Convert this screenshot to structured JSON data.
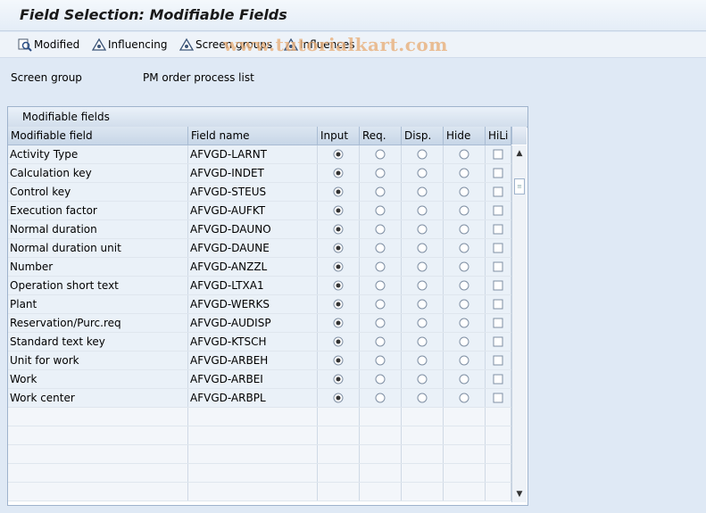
{
  "window": {
    "title": "Field Selection: Modifiable Fields"
  },
  "toolbar": {
    "buttons": [
      {
        "label": "Modified",
        "icon": "modified-icon"
      },
      {
        "label": "Influencing",
        "icon": "influencing-icon"
      },
      {
        "label": "Screen groups",
        "icon": "screen-groups-icon"
      },
      {
        "label": "Influences",
        "icon": "influences-icon"
      }
    ]
  },
  "watermark": "www.tutorialkart.com",
  "form": {
    "screen_group_label": "Screen group",
    "screen_group_value": "PM order process list"
  },
  "table": {
    "title": "Modifiable fields",
    "columns": [
      "Modifiable field",
      "Field name",
      "Input",
      "Req.",
      "Disp.",
      "Hide",
      "HiLi"
    ],
    "rows": [
      {
        "field": "Activity Type",
        "name": "AFVGD-LARNT",
        "selected": "Input",
        "hili": false
      },
      {
        "field": "Calculation key",
        "name": "AFVGD-INDET",
        "selected": "Input",
        "hili": false
      },
      {
        "field": "Control key",
        "name": "AFVGD-STEUS",
        "selected": "Input",
        "hili": false
      },
      {
        "field": "Execution factor",
        "name": "AFVGD-AUFKT",
        "selected": "Input",
        "hili": false
      },
      {
        "field": "Normal duration",
        "name": "AFVGD-DAUNO",
        "selected": "Input",
        "hili": false
      },
      {
        "field": "Normal duration unit",
        "name": "AFVGD-DAUNE",
        "selected": "Input",
        "hili": false
      },
      {
        "field": "Number",
        "name": "AFVGD-ANZZL",
        "selected": "Input",
        "hili": false
      },
      {
        "field": "Operation short text",
        "name": "AFVGD-LTXA1",
        "selected": "Input",
        "hili": false
      },
      {
        "field": "Plant",
        "name": "AFVGD-WERKS",
        "selected": "Input",
        "hili": false
      },
      {
        "field": "Reservation/Purc.req",
        "name": "AFVGD-AUDISP",
        "selected": "Input",
        "hili": false
      },
      {
        "field": "Standard text key",
        "name": "AFVGD-KTSCH",
        "selected": "Input",
        "hili": false
      },
      {
        "field": "Unit for work",
        "name": "AFVGD-ARBEH",
        "selected": "Input",
        "hili": false
      },
      {
        "field": "Work",
        "name": "AFVGD-ARBEI",
        "selected": "Input",
        "hili": false
      },
      {
        "field": "Work center",
        "name": "AFVGD-ARBPL",
        "selected": "Input",
        "hili": false
      }
    ],
    "empty_rows": 5
  }
}
